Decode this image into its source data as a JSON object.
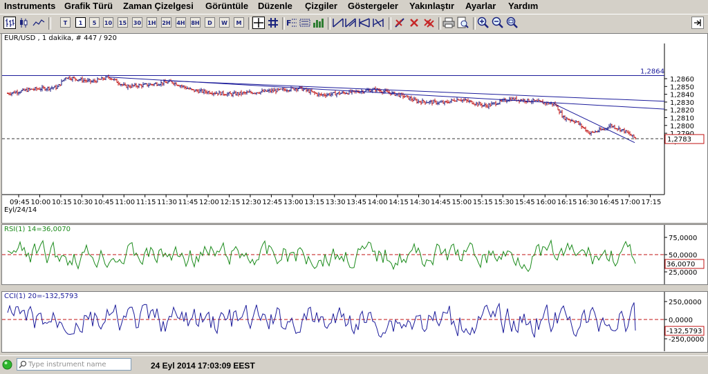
{
  "menu": [
    "Instruments",
    "Grafik Türü",
    "Zaman Çizelgesi",
    "Görüntüle",
    "Düzenle",
    "Çizgiler",
    "Göstergeler",
    "Yakınlaştır",
    "Ayarlar",
    "Yardım"
  ],
  "toolbar": {
    "timeframes": [
      "T",
      "1",
      "5",
      "10",
      "15",
      "30",
      "1H",
      "2H",
      "4H",
      "8H",
      "D",
      "W",
      "M"
    ],
    "active_timeframe": "1",
    "icons": [
      "bar-chart-icon",
      "candle-chart-icon",
      "line-chart-icon",
      "crosshair-icon",
      "grid-icon",
      "fibonacci-icon",
      "channel-icon",
      "text-icon",
      "histogram-icon",
      "trendline-icon",
      "parallel-lines-icon",
      "andrews-pitchfork-icon",
      "regression-icon",
      "delete-drawing-icon",
      "delete-icon",
      "delete-all-icon",
      "print-icon",
      "print-preview-icon",
      "zoom-in-icon",
      "zoom-out-icon",
      "zoom-reset-icon",
      "collapse-panel-icon"
    ]
  },
  "main_chart": {
    "title": "EUR/USD , 1 dakika, # 447 / 920",
    "subtitle": "Eyl/24/14",
    "price_ticks": [
      "1,2860",
      "1,2850",
      "1,2840",
      "1,2830",
      "1,2820",
      "1,2810",
      "1,2800",
      "1,2790",
      "1,2780"
    ],
    "top_line_value": "1,2864",
    "last_price": "1,2783",
    "time_ticks": [
      "09:45",
      "10:00",
      "10:15",
      "10:30",
      "10:45",
      "11:00",
      "11:15",
      "11:30",
      "11:45",
      "12:00",
      "12:15",
      "12:30",
      "12:45",
      "13:00",
      "13:15",
      "13:30",
      "13:45",
      "14:00",
      "14:15",
      "14:30",
      "14:45",
      "15:00",
      "15:15",
      "15:30",
      "15:45",
      "16:00",
      "16:15",
      "16:30",
      "16:45",
      "17:00",
      "17:15"
    ],
    "up_color": "#1a1a80",
    "down_color": "#c01010",
    "line_color": "#1a1a9a"
  },
  "rsi": {
    "title": "RSI(1) 14=36,0070",
    "ticks": [
      "75,0000",
      "50,0000",
      "25,0000"
    ],
    "last_value": "36,0070",
    "color": "#1a8a1a"
  },
  "cci": {
    "title": "CCI(1) 20=-132,5793",
    "ticks": [
      "250,0000",
      "0,0000",
      "-250,0000"
    ],
    "last_value": "-132,5793",
    "color": "#1a1a9a"
  },
  "status": {
    "search_placeholder": "Type instrument name",
    "datetime": "24 Eyl 2014 17:03:09 EEST",
    "connection_color": "#2db52d"
  }
}
